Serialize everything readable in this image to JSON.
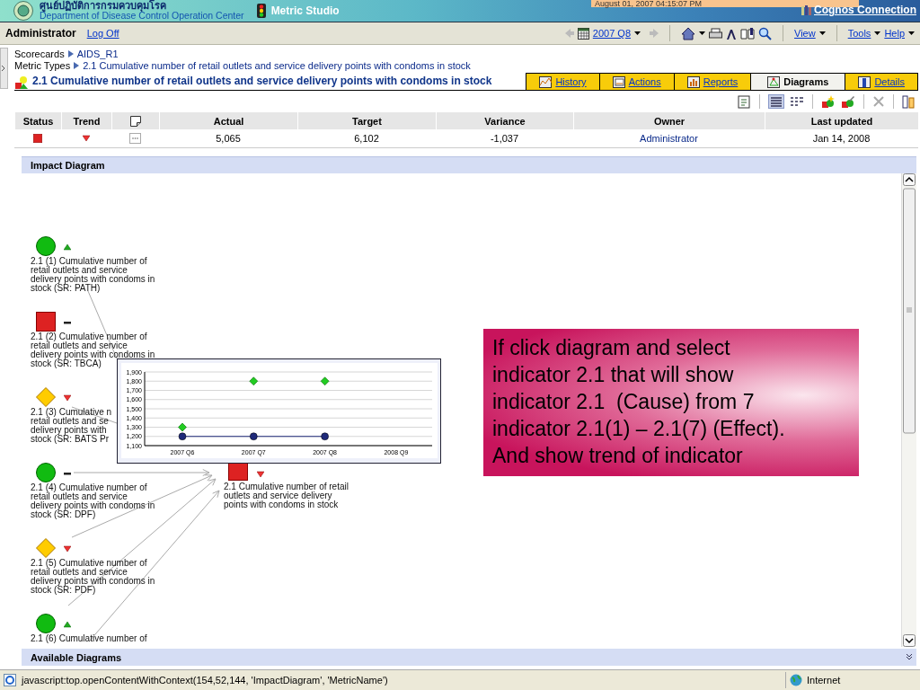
{
  "header": {
    "org_name_thai": "ศูนย์ปฏิบัติการกรมควบคุมโรค",
    "org_name": "Department of Disease Control Operation Center",
    "app_title": "Metric Studio",
    "timestamp": "August 01, 2007 04:15:07 PM",
    "portal_link": "Cognos Connection"
  },
  "toolbar": {
    "user": "Administrator",
    "logoff": "Log Off",
    "period": "2007 Q8",
    "menus": [
      "View",
      "Tools",
      "Help"
    ]
  },
  "breadcrumbs": [
    {
      "label": "Scorecards",
      "value": "AIDS_R1"
    },
    {
      "label": "Metric Types",
      "value": "2.1 Cumulative number of retail outlets and service delivery points with condoms in stock"
    }
  ],
  "metric_title": "2.1 Cumulative number of retail outlets and service delivery points with condoms in stock",
  "tabs": [
    {
      "label": "History",
      "selected": false
    },
    {
      "label": "Actions",
      "selected": false
    },
    {
      "label": "Reports",
      "selected": false
    },
    {
      "label": "Diagrams",
      "selected": true
    },
    {
      "label": "Details",
      "selected": false
    }
  ],
  "table": {
    "columns": [
      "Status",
      "Trend",
      "Actual",
      "Target",
      "Variance",
      "Owner",
      "Last updated"
    ],
    "row": {
      "status": {
        "kind": "square",
        "color": "#dd2222"
      },
      "trend": {
        "kind": "down"
      },
      "actual": "5,065",
      "target": "6,102",
      "variance": "-1,037",
      "owner": "Administrator",
      "last_updated": "Jan 14, 2008"
    }
  },
  "impact_diagram": {
    "title": "Impact Diagram",
    "causes": [
      {
        "status": {
          "kind": "circle",
          "color": "#11bb11"
        },
        "trend": {
          "kind": "up"
        },
        "label_lines": [
          "2.1 (1) Cumulative number of",
          "retail outlets and service",
          "delivery points with condoms in",
          "stock (SR: PATH)"
        ]
      },
      {
        "status": {
          "kind": "square",
          "color": "#dd2222"
        },
        "trend": {
          "kind": "flat"
        },
        "label_lines": [
          "2.1 (2) Cumulative number of",
          "retail outlets and service",
          "delivery points with condoms in",
          "stock (SR: TBCA)"
        ]
      },
      {
        "status": {
          "kind": "diamond",
          "color": "#ffcc00"
        },
        "trend": {
          "kind": "down"
        },
        "label_lines": [
          "2.1 (3) Cumulative n",
          "retail outlets and se",
          "delivery points with",
          "stock (SR: BATS Pr"
        ]
      },
      {
        "status": {
          "kind": "circle",
          "color": "#11bb11"
        },
        "trend": {
          "kind": "flat"
        },
        "label_lines": [
          "2.1 (4) Cumulative number of",
          "retail outlets and service",
          "delivery points with condoms in",
          "stock (SR: DPF)"
        ]
      },
      {
        "status": {
          "kind": "diamond",
          "color": "#ffcc00"
        },
        "trend": {
          "kind": "down"
        },
        "label_lines": [
          "2.1 (5) Cumulative number of",
          "retail outlets and service",
          "delivery points with condoms in",
          "stock (SR: PDF)"
        ]
      },
      {
        "status": {
          "kind": "circle",
          "color": "#11bb11"
        },
        "trend": {
          "kind": "up"
        },
        "label_lines": [
          "2.1 (6) Cumulative number of"
        ]
      }
    ],
    "effect": {
      "status": {
        "kind": "square",
        "color": "#dd2222"
      },
      "trend": {
        "kind": "down"
      },
      "label_lines": [
        "2.1 Cumulative number of retail",
        "outlets and service delivery",
        "points with condoms in stock"
      ]
    },
    "chart_data": {
      "type": "line",
      "categories": [
        "2007 Q6",
        "2007 Q7",
        "2007 Q8",
        "2008 Q9"
      ],
      "grid": true,
      "series": [
        {
          "type": "line",
          "color": "#1f2a7a",
          "marker": "circle",
          "values": [
            1200,
            1200,
            1200,
            null
          ]
        },
        {
          "type": "scatter",
          "color": "#22cc22",
          "marker": "diamond",
          "values": [
            1300,
            1800,
            1800,
            null
          ]
        }
      ],
      "ylim": [
        1100,
        1900
      ],
      "yticks": [
        {
          "value": 1100,
          "label": "1,100"
        },
        {
          "value": 1200,
          "label": "1,200"
        },
        {
          "value": 1300,
          "label": "1,300"
        },
        {
          "value": 1400,
          "label": "1,400"
        },
        {
          "value": 1500,
          "label": "1,500"
        },
        {
          "value": 1600,
          "label": "1,600"
        },
        {
          "value": 1700,
          "label": "1,700"
        },
        {
          "value": 1800,
          "label": "1,800"
        },
        {
          "value": 1900,
          "label": "1,900"
        }
      ]
    }
  },
  "available_diagrams": "Available Diagrams",
  "callout": "If click diagram and select\nindicator 2.1 that will show\nindicator 2.1  (Cause) from 7\nindicator 2.1(1) – 2.1(7) (Effect).\nAnd show trend of indicator",
  "status_bar": {
    "text": "javascript:top.openContentWithContext(154,52,144, 'ImpactDiagram', 'MetricName')",
    "zone": "Internet"
  }
}
